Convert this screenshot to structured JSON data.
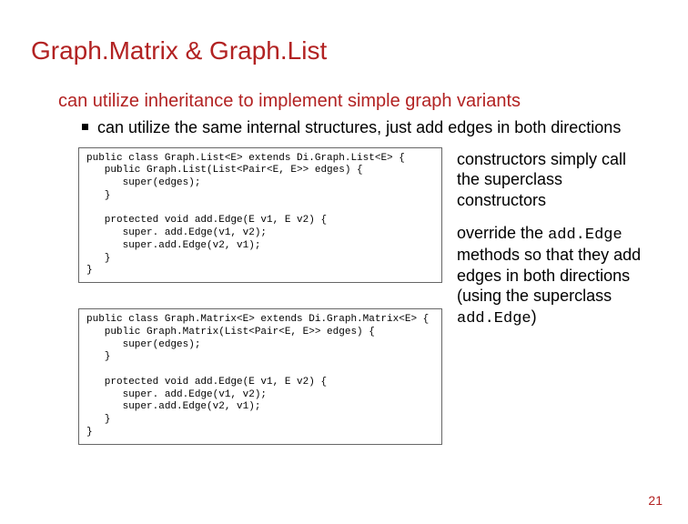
{
  "title": "Graph.Matrix & Graph.List",
  "subtitle": "can utilize inheritance to implement simple graph variants",
  "bullet1": "can utilize the same internal structures, just add edges in both directions",
  "code1": "public class Graph.List<E> extends Di.Graph.List<E> {\n   public Graph.List(List<Pair<E, E>> edges) {\n      super(edges);\n   }\n\n   protected void add.Edge(E v1, E v2) {\n      super. add.Edge(v1, v2);\n      super.add.Edge(v2, v1);\n   }\n}",
  "code2": "public class Graph.Matrix<E> extends Di.Graph.Matrix<E> {\n   public Graph.Matrix(List<Pair<E, E>> edges) {\n      super(edges);\n   }\n\n   protected void add.Edge(E v1, E v2) {\n      super. add.Edge(v1, v2);\n      super.add.Edge(v2, v1);\n   }\n}",
  "side1": "constructors simply call the superclass constructors",
  "side2_a": "override the ",
  "side2_code1": "add.Edge",
  "side2_b": " methods so that they add edges in both directions (using the superclass ",
  "side2_code2": "add.Edge",
  "side2_c": ")",
  "page": "21"
}
